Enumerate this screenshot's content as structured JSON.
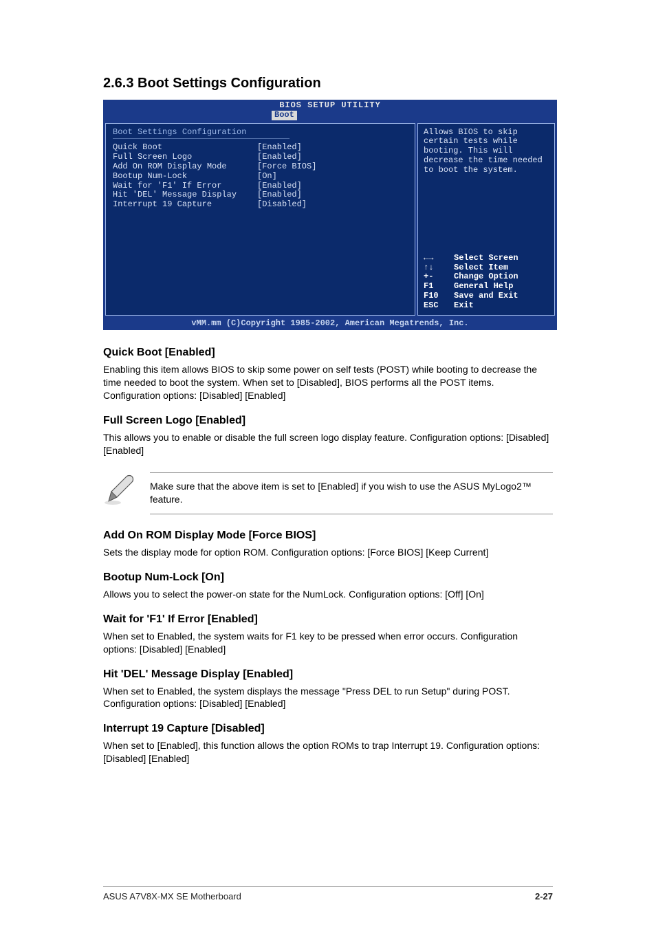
{
  "section_title": "2.6.3 Boot Settings Configuration",
  "bios": {
    "header_title": "BIOS SETUP UTILITY",
    "tab": "Boot",
    "panel_heading": "Boot Settings Configuration",
    "items": [
      {
        "label": "Quick Boot",
        "value": "[Enabled]"
      },
      {
        "label": "Full Screen Logo",
        "value": "[Enabled]"
      },
      {
        "label": "Add On ROM Display Mode",
        "value": "[Force BIOS]"
      },
      {
        "label": "Bootup Num-Lock",
        "value": "[On]"
      },
      {
        "label": "Wait for 'F1' If Error",
        "value": "[Enabled]"
      },
      {
        "label": "Hit 'DEL' Message Display",
        "value": "[Enabled]"
      },
      {
        "label": "Interrupt 19 Capture",
        "value": "[Disabled]"
      }
    ],
    "help_text": "Allows BIOS to skip certain tests while booting. This will decrease the time needed to boot the system.",
    "nav": [
      {
        "key": "←→",
        "desc": "Select Screen"
      },
      {
        "key": "↑↓",
        "desc": "Select Item"
      },
      {
        "key": "+-",
        "desc": "Change Option"
      },
      {
        "key": "F1",
        "desc": "General Help"
      },
      {
        "key": "F10",
        "desc": "Save and Exit"
      },
      {
        "key": "ESC",
        "desc": "Exit"
      }
    ],
    "footer": "vMM.mm (C)Copyright 1985-2002, American Megatrends, Inc."
  },
  "options": [
    {
      "head": "Quick Boot [Enabled]",
      "body": "Enabling this item allows BIOS to skip some power on self tests (POST) while booting to decrease the time needed to boot the system. When set to [Disabled], BIOS performs all the POST items. Configuration options: [Disabled] [Enabled]"
    },
    {
      "head": "Full Screen Logo [Enabled]",
      "body": "This allows you to enable or disable the full screen logo display feature. Configuration options: [Disabled] [Enabled]"
    }
  ],
  "note_text": "Make sure that the above item is set to [Enabled] if you wish to use the ASUS MyLogo2™ feature.",
  "options2": [
    {
      "head": "Add On ROM Display Mode [Force BIOS]",
      "body": "Sets the display mode for option ROM. Configuration options: [Force BIOS] [Keep Current]"
    },
    {
      "head": "Bootup Num-Lock [On]",
      "body": "Allows you to select the power-on state for the NumLock. Configuration options: [Off] [On]"
    },
    {
      "head": "Wait for 'F1' If Error [Enabled]",
      "body": "When set to Enabled, the system waits for F1 key to be pressed when error occurs. Configuration options: [Disabled] [Enabled]"
    },
    {
      "head": "Hit 'DEL' Message Display [Enabled]",
      "body": "When set to Enabled, the system displays the message \"Press DEL to run Setup\" during POST. Configuration options: [Disabled] [Enabled]"
    },
    {
      "head": "Interrupt 19 Capture [Disabled]",
      "body": "When set to [Enabled], this function allows the option ROMs to trap Interrupt 19. Configuration options: [Disabled] [Enabled]"
    }
  ],
  "footer": {
    "left": "ASUS A7V8X-MX SE Motherboard",
    "right": "2-27"
  }
}
